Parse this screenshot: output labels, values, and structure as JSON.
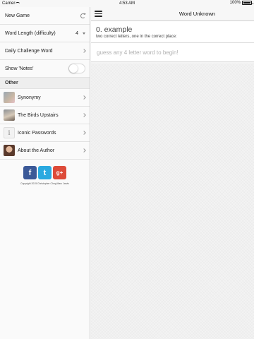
{
  "status": {
    "carrier": "Carrier",
    "time": "4:53 AM",
    "battery": "100%",
    "battery_level": 1.0
  },
  "sidebar": {
    "new_game": "New Game",
    "word_length_label": "Word Length (difficulty)",
    "word_length_value": "4",
    "daily_challenge": "Daily Challenge Word",
    "show_notes": "Show 'Notes'",
    "show_notes_on": false,
    "other_header": "Other",
    "other_items": [
      {
        "label": "Synonymy",
        "icon": "synonymy-app-icon"
      },
      {
        "label": "The Birds Upstairs",
        "icon": "birds-upstairs-app-icon"
      },
      {
        "label": "Iconic Passwords",
        "icon": "iconic-passwords-app-icon"
      },
      {
        "label": "About the Author",
        "icon": "author-photo"
      }
    ],
    "social": {
      "facebook": "f",
      "twitter": "t",
      "google": "g+"
    },
    "copyright": "Copyright 2015 Christopher Chng Marc Jarvis"
  },
  "main": {
    "title": "Word Unknown",
    "example_title": "0. example",
    "example_hint": "two correct letters, one in the correct place:",
    "guess_placeholder": "guess any 4 letter word to begin!",
    "guess_value": ""
  },
  "colors": {
    "facebook": "#3b5998",
    "twitter": "#2aa9e0",
    "google": "#dd4b39"
  }
}
